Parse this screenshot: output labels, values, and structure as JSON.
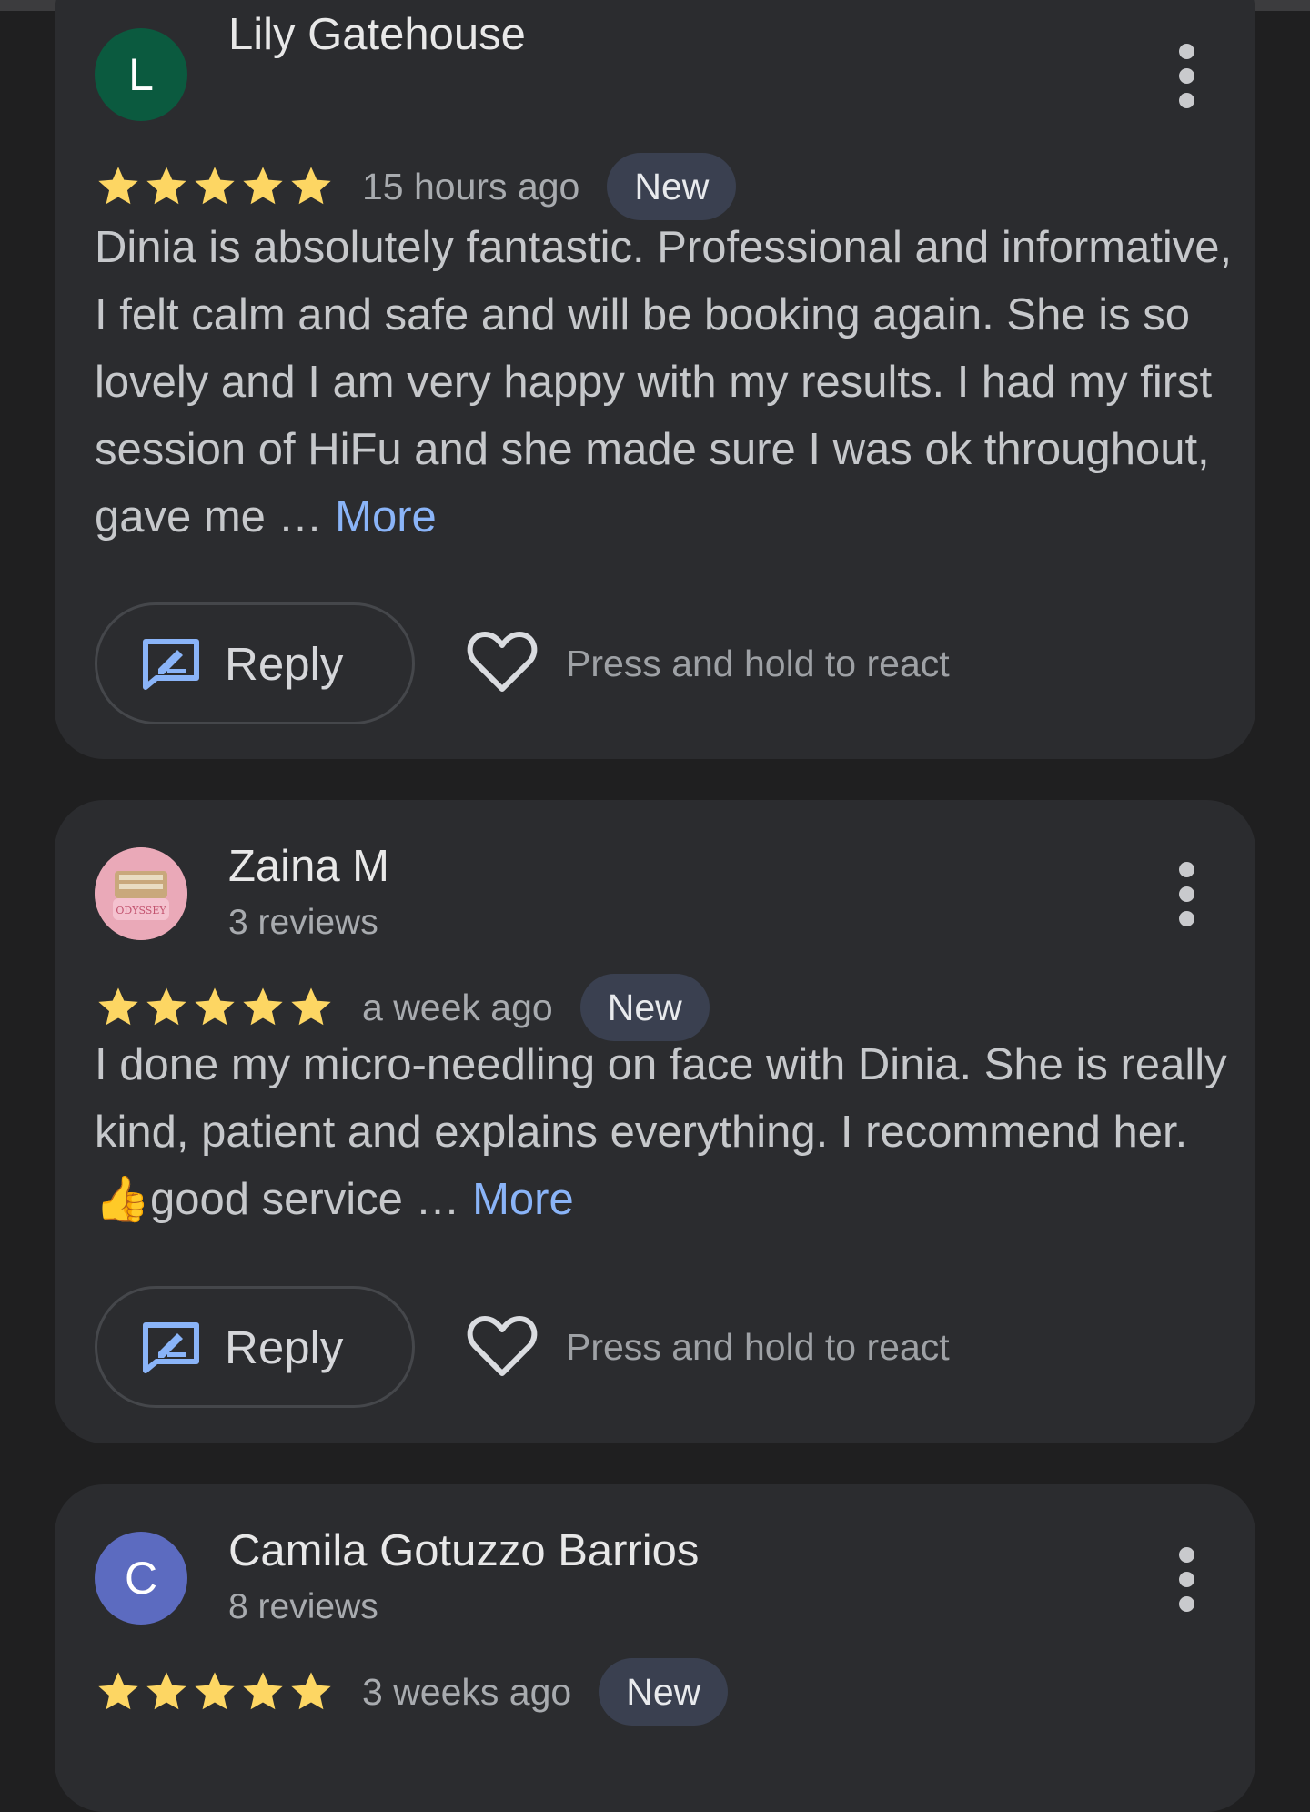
{
  "reviews": [
    {
      "author": "Lily Gatehouse",
      "avatar_initial": "L",
      "avatar_color": "#0b5a3f",
      "meta": "",
      "rating": 5,
      "time": "15 hours ago",
      "badge": "New",
      "text": "Dinia is absolutely fantastic. Professional and informative, I felt calm and safe and will be booking again. She is so lovely and I am very happy with my results. I had my first session of HiFu and she made sure I was ok throughout, gave me … ",
      "more": "More",
      "reply_label": "Reply",
      "react_hint": "Press and hold to react"
    },
    {
      "author": "Zaina M",
      "avatar_initial": "",
      "avatar_color": "#e9a7b6",
      "avatar_logo_text": "ODYSSEY",
      "meta": "3 reviews",
      "rating": 5,
      "time": "a week ago",
      "badge": "New",
      "text_before_emoji": "I done my micro-needling on face with Dinia. She is really kind, patient and explains everything. I recommend her. ",
      "emoji": "👍",
      "text_after_emoji": "good service … ",
      "more": "More",
      "reply_label": "Reply",
      "react_hint": "Press and hold to react"
    },
    {
      "author": "Camila Gotuzzo Barrios",
      "avatar_initial": "C",
      "avatar_color": "#5c6bc0",
      "meta": "8 reviews",
      "rating": 5,
      "time": "3 weeks ago",
      "badge": "New"
    }
  ],
  "colors": {
    "star": "#fdd663",
    "link": "#8ab4f8",
    "card": "#2b2c2f",
    "background": "#1f1f20"
  },
  "icons": {
    "menu": "more-vert-icon",
    "reply": "reply-edit-icon",
    "react": "heart-outline-icon",
    "star": "star-filled-icon"
  }
}
